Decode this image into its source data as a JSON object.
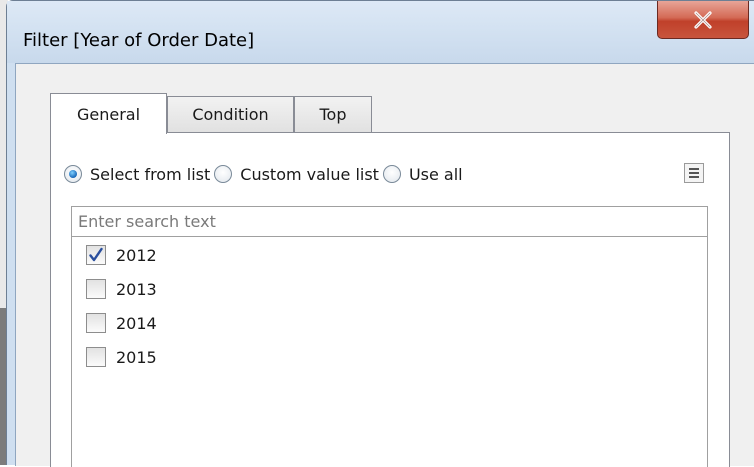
{
  "window": {
    "title": "Filter [Year of Order Date]",
    "close_icon": "close-x-icon"
  },
  "tabs": [
    {
      "label": "General",
      "active": true
    },
    {
      "label": "Condition",
      "active": false
    },
    {
      "label": "Top",
      "active": false
    }
  ],
  "selection_mode": {
    "options": [
      {
        "label": "Select from list",
        "selected": true
      },
      {
        "label": "Custom value list",
        "selected": false
      },
      {
        "label": "Use all",
        "selected": false
      }
    ],
    "menu_icon": "list-menu-icon"
  },
  "search": {
    "placeholder": "Enter search text",
    "value": ""
  },
  "values": [
    {
      "label": "2012",
      "checked": true
    },
    {
      "label": "2013",
      "checked": false
    },
    {
      "label": "2014",
      "checked": false
    },
    {
      "label": "2015",
      "checked": false
    }
  ],
  "colors": {
    "close_button": "#c8553d",
    "radio_selected": "#1767b8",
    "checkmark": "#2a4f9e"
  }
}
